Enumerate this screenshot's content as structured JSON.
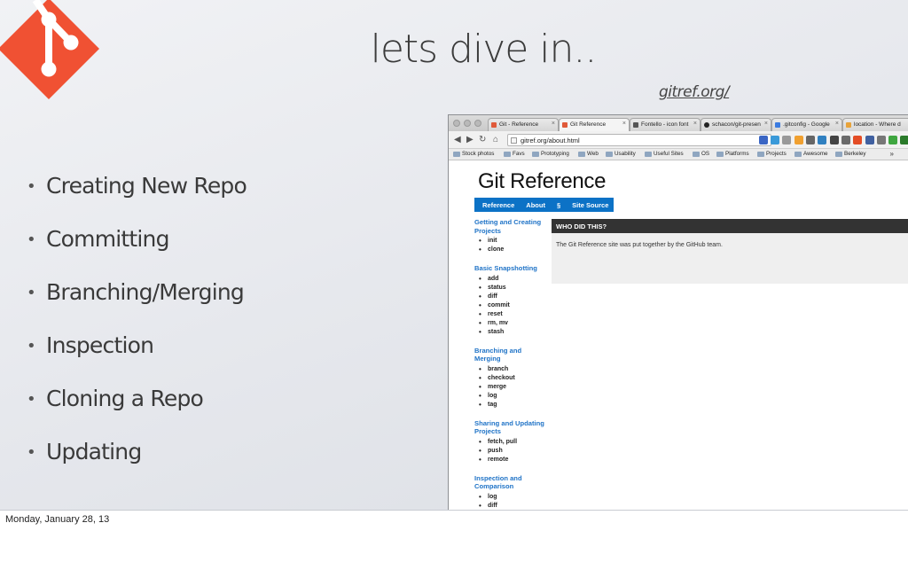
{
  "slide": {
    "title": "lets dive in..",
    "link": "gitref.org/",
    "bullets": [
      "Creating New Repo",
      "Committing",
      "Branching/Merging",
      "Inspection",
      "Cloning a Repo",
      "Updating"
    ]
  },
  "browser": {
    "tabs": [
      "Git - Reference",
      "Git Reference",
      "Fontello - icon font",
      "schacon/git-presen",
      ".gitconfig - Google",
      "location - Where d"
    ],
    "address": "gitref.org/about.html",
    "bookmarks": [
      "Stock photos",
      "Favs",
      "Prototyping",
      "Web",
      "Usability",
      "Useful Sites",
      "OS",
      "Platforms",
      "Projects",
      "Awesome",
      "Berkeley"
    ],
    "bookmarks_more": "»",
    "page": {
      "site_title": "Git Reference",
      "nav": [
        "Reference",
        "About",
        "§",
        "Site Source"
      ],
      "sections": [
        {
          "title": "Getting and Creating Projects",
          "items": [
            "init",
            "clone"
          ]
        },
        {
          "title": "Basic Snapshotting",
          "items": [
            "add",
            "status",
            "diff",
            "commit",
            "reset",
            "rm, mv",
            "stash"
          ]
        },
        {
          "title": "Branching and Merging",
          "items": [
            "branch",
            "checkout",
            "merge",
            "log",
            "tag"
          ]
        },
        {
          "title": "Sharing and Updating Projects",
          "items": [
            "fetch, pull",
            "push",
            "remote"
          ]
        },
        {
          "title": "Inspection and Comparison",
          "items": [
            "log",
            "diff"
          ]
        }
      ],
      "main_header": "WHO DID THIS?",
      "main_text": "The Git Reference site was put together by the GitHub team."
    }
  },
  "footer": {
    "date": "Monday, January 28, 13"
  },
  "colors": {
    "git_logo": "#f05133",
    "nav_blue": "#0c72c6",
    "link_blue": "#1f73c7"
  }
}
